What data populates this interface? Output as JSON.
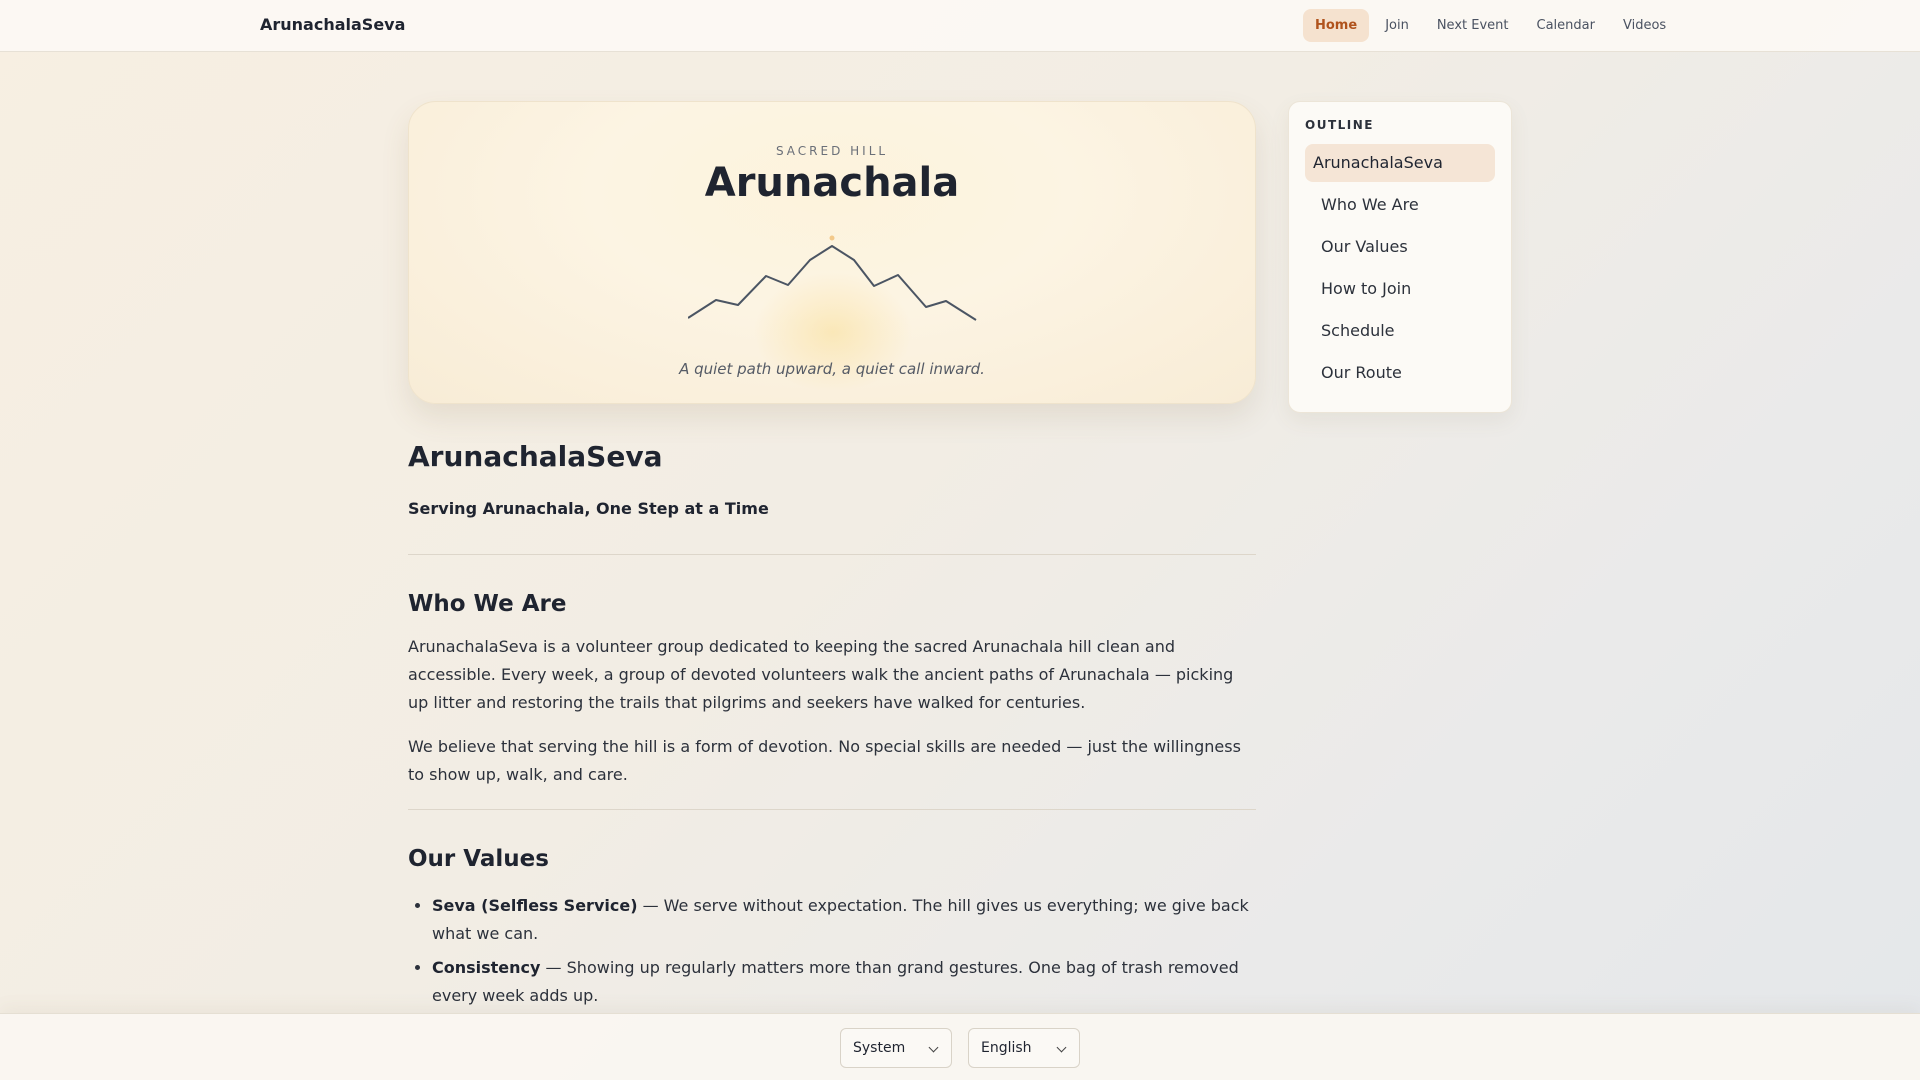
{
  "nav": {
    "brand": "ArunachalaSeva",
    "links": [
      {
        "label": "Home",
        "active": true
      },
      {
        "label": "Join",
        "active": false
      },
      {
        "label": "Next Event",
        "active": false
      },
      {
        "label": "Calendar",
        "active": false
      },
      {
        "label": "Videos",
        "active": false
      }
    ]
  },
  "hero": {
    "eyebrow": "SACRED HILL",
    "title": "Arunachala",
    "tagline": "A quiet path upward, a quiet call inward."
  },
  "main": {
    "title": "ArunachalaSeva",
    "subtitle": "Serving Arunachala, One Step at a Time",
    "who_heading": "Who We Are",
    "who_p1": "ArunachalaSeva is a volunteer group dedicated to keeping the sacred Arunachala hill clean and accessible. Every week, a group of devoted volunteers walk the ancient paths of Arunachala — picking up litter and restoring the trails that pilgrims and seekers have walked for centuries.",
    "who_p2": "We believe that serving the hill is a form of devotion. No special skills are needed — just the willingness to show up, walk, and care.",
    "values_heading": "Our Values",
    "values": [
      {
        "term": "Seva (Selfless Service)",
        "text": " — We serve without expectation. The hill gives us everything; we give back what we can."
      },
      {
        "term": "Consistency",
        "text": " — Showing up regularly matters more than grand gestures. One bag of trash removed every week adds up."
      }
    ]
  },
  "outline": {
    "heading": "OUTLINE",
    "items": [
      "ArunachalaSeva",
      "Who We Are",
      "Our Values",
      "How to Join",
      "Schedule",
      "Our Route"
    ]
  },
  "footer": {
    "theme_select": "System",
    "language_select": "English"
  }
}
